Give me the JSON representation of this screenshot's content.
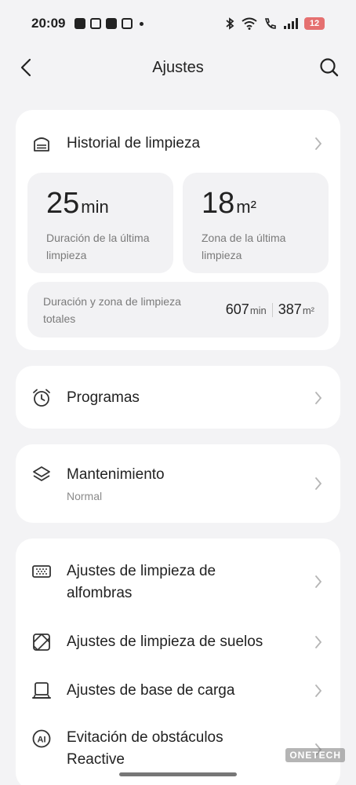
{
  "status_bar": {
    "time": "20:09",
    "battery": "12",
    "icons": [
      "bluetooth-icon",
      "wifi-icon",
      "call-icon",
      "signal-icon"
    ]
  },
  "header": {
    "title": "Ajustes",
    "back_icon": "chevron-left-icon",
    "search_icon": "search-icon"
  },
  "history": {
    "title": "Historial de limpieza",
    "last_duration": {
      "value": "25",
      "unit": "min",
      "label": "Duración de la última limpieza"
    },
    "last_area": {
      "value": "18",
      "unit": "m²",
      "label": "Zona de la última limpieza"
    },
    "totals": {
      "label": "Duración y zona de limpieza totales",
      "duration_value": "607",
      "duration_unit": "min",
      "area_value": "387",
      "area_unit": "m²"
    }
  },
  "menu": {
    "programs": {
      "label": "Programas",
      "icon": "alarm-clock-icon"
    },
    "maintenance": {
      "label": "Mantenimiento",
      "sub": "Normal",
      "icon": "layers-icon"
    },
    "carpet": {
      "label": "Ajustes de limpieza de alfombras",
      "icon": "carpet-icon"
    },
    "floor": {
      "label": "Ajustes de limpieza de suelos",
      "icon": "floor-icon"
    },
    "dock": {
      "label": "Ajustes de base de carga",
      "icon": "charging-dock-icon"
    },
    "obstacles": {
      "label": "Evitación de obstáculos Reactive",
      "icon": "ai-icon"
    }
  },
  "watermark": "ONETECH",
  "colors": {
    "background": "#f3f3f5",
    "card": "#ffffff",
    "stat_box": "#f2f2f4",
    "battery_low": "#e57070",
    "muted_text": "#7a7a7a"
  }
}
